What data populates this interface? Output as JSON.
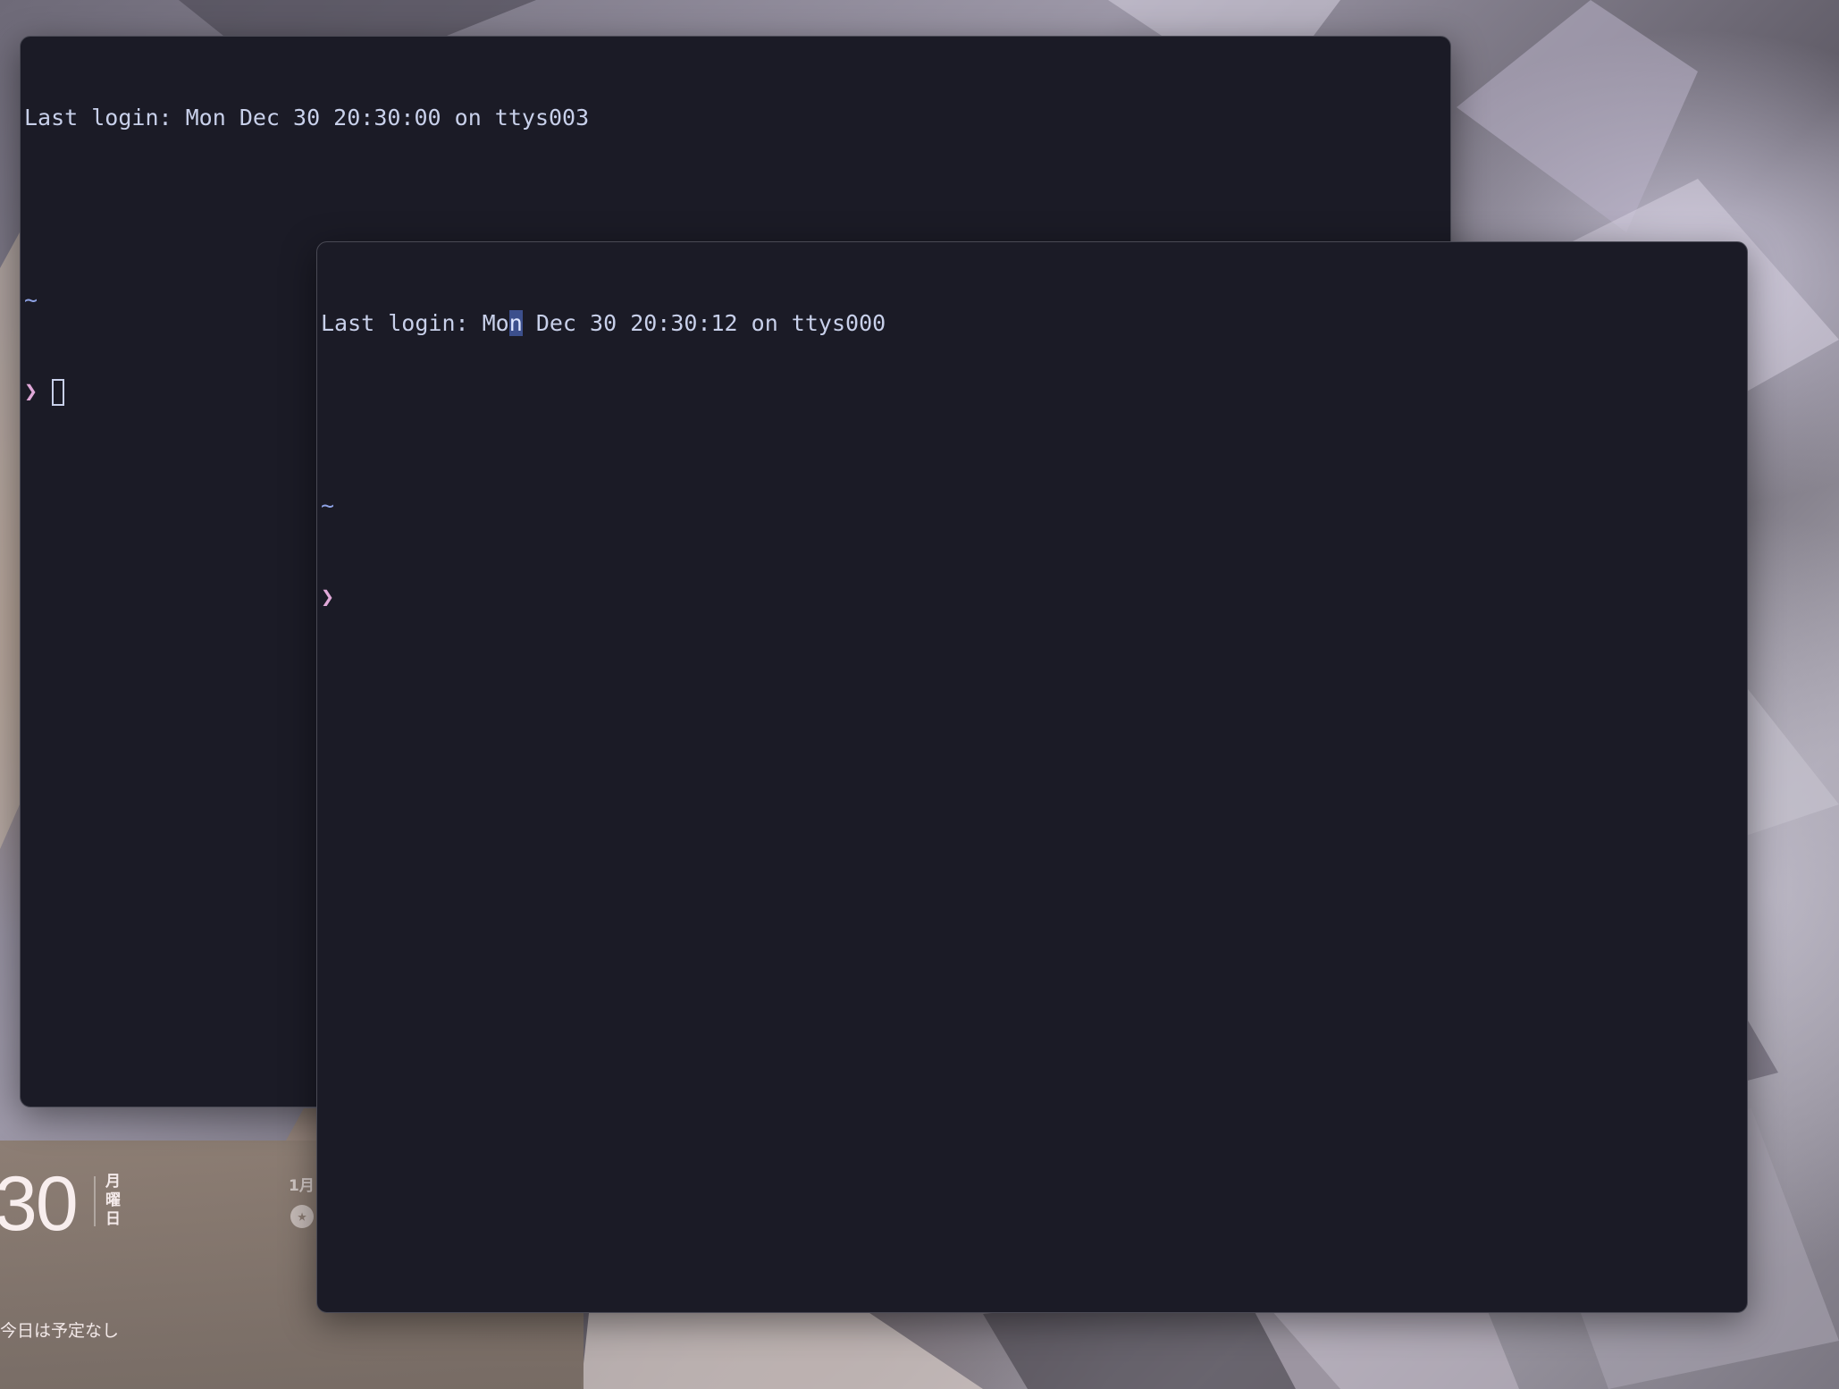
{
  "colors": {
    "terminal_bg": "#1b1b26",
    "terminal_text": "#c8d0ea",
    "tilde": "#8fa3e6",
    "prompt": "#e0a8d8",
    "selection": "#3c4f8c"
  },
  "terminal_back": {
    "login_line": "Last login: Mon Dec 30 20:30:00 on ttys003",
    "cwd": "~",
    "prompt": "❯"
  },
  "terminal_front": {
    "login_prefix": "Last login: Mo",
    "login_selected": "n",
    "login_suffix": " Dec 30 20:30:12 on ttys000",
    "cwd": "~",
    "prompt": "❯"
  },
  "widget": {
    "day_number": "30",
    "weekday": "月曜日",
    "month_label": "1月",
    "no_events": "今日は予定なし",
    "icon": "star-icon"
  }
}
